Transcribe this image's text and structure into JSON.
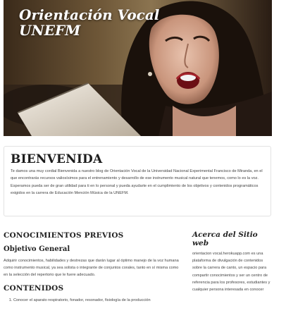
{
  "hero": {
    "title_line1": "Orientación Vocal",
    "title_line2": "UNEFM"
  },
  "welcome": {
    "heading": "BIENVENIDA",
    "text": "Te damos una muy cordial Bienvenida a nuestro blog de Orientación Vocal de la Universidad Nacional Experimental Francisco de Miranda, en el que encontrarás recursos valiosísimos para el entrenamiento y desarrollo de ese instrumento musical natural que tenemos, como lo es la voz. Esperamos pueda ser de gran utilidad para ti en lo personal y pueda ayudarte en el cumplimiento de los objetivos y contenidos programáticos exigidos en la carrera de Educación Mención Música de la UNEFM."
  },
  "main": {
    "section_title": "CONOCIMIENTOS PREVIOS",
    "objective_title": "Objetivo General",
    "objective_text": "Adquirir conocimientos, habilidades y destrezas que darán lugar al óptimo manejo de la voz humana como instrumento musical, ya sea solista o integrante de conjuntos corales, tanto en sí misma como en la selección del repertorio que le fuere adecuado.",
    "contents_title": "CONTENIDOS",
    "contents_items": [
      "Conocer el aparato respiratorio, fonador, resonador, fisiología de la producción"
    ]
  },
  "sidebar": {
    "title": "Acerca del Sitio web",
    "text": "orientacion vocal.herokuapp.com es una plataforma de divulgación de contenidos sobre la carrera de canto, un espacio para compartir conocimientos y ser un centro de referencia para los profesores, estudiantes y cualquier persona interesada en conocer"
  }
}
